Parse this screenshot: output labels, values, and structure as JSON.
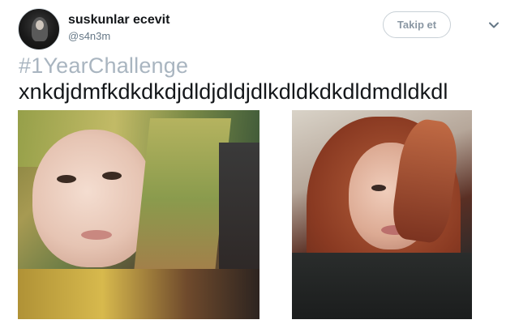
{
  "user": {
    "display_name": "suskunlar ecevit",
    "handle": "@s4n3m",
    "avatar_icon": "profile-avatar"
  },
  "actions": {
    "follow_label": "Takip et",
    "more_icon": "chevron-down-icon"
  },
  "tweet": {
    "hashtag": "#1YearChallenge",
    "text": "xnkdjdmfkdkdkdjdldjdldjdlkdldkdkdldmdldkdl"
  },
  "colors": {
    "hashtag": "#a9b5c0",
    "text": "#14171a",
    "handle": "#657786",
    "button_border": "#c8d0d6"
  }
}
